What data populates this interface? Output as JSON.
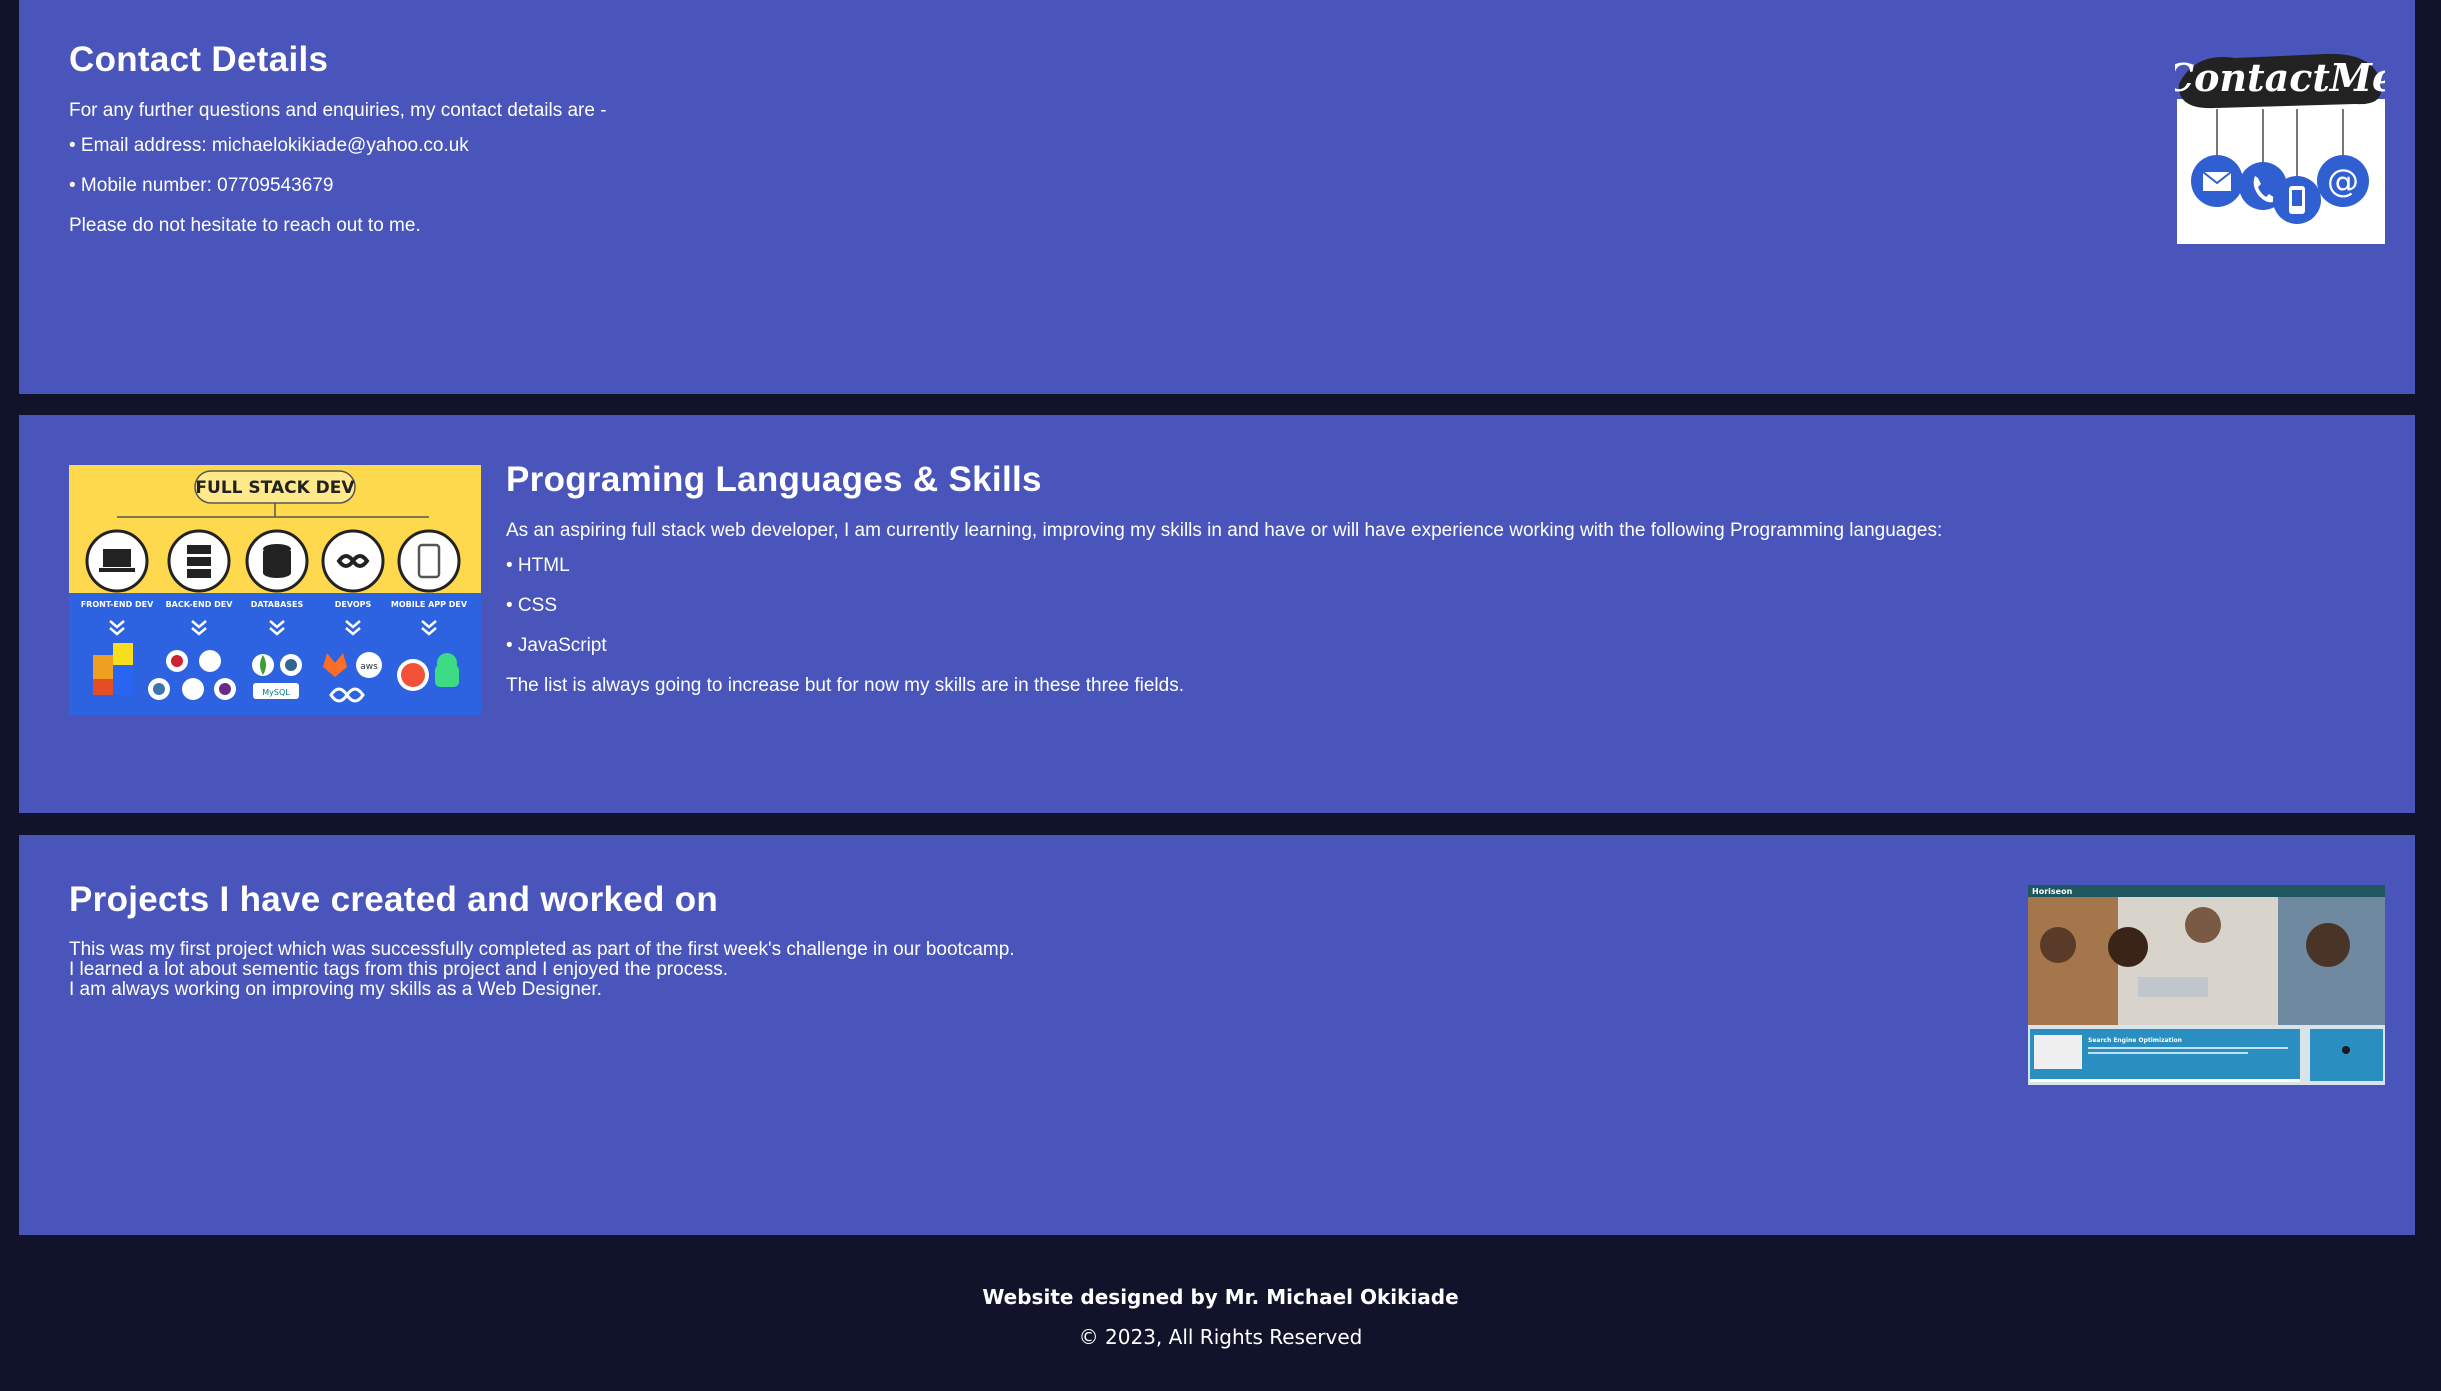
{
  "contact": {
    "title": "Contact Details",
    "intro": "For any further questions and enquiries, my contact details are -",
    "email_line": "• Email address: michaelokikiade@yahoo.co.uk",
    "mobile_line": "• Mobile number: 07709543679",
    "outro": "Please do not hesitate to reach out to me.",
    "image_caption": "ContactMe"
  },
  "skills": {
    "image": {
      "header": "FULL STACK DEV",
      "columns": [
        "FRONT-END DEV",
        "BACK-END DEV",
        "DATABASES",
        "DEVOPS",
        "MOBILE APP DEV"
      ]
    },
    "title": "Programing Languages & Skills",
    "intro": "As an aspiring full stack web developer, I am currently learning, improving my skills in and have or will have experience working with the following Programming languages:",
    "languages": [
      "• HTML",
      "• CSS",
      "• JavaScript"
    ],
    "outro": "The list is always going to increase but for now my skills are in these three fields."
  },
  "projects": {
    "title": "Projects I have created and worked on",
    "lines": [
      "This was my first project which was successfully completed as part of the first week's challenge in our bootcamp.",
      "I learned a lot about sementic tags from this project and I enjoyed the process.",
      "I am always working on improving my skills as a Web Designer."
    ],
    "screenshot": {
      "brand": "Horiseon",
      "section_title": "Search Engine Optimization"
    }
  },
  "footer": {
    "credit": "Website designed by Mr. Michael Okikiade",
    "copyright": "© 2023, All Rights Reserved"
  },
  "colors": {
    "page_bg": "#11132b",
    "panel_bg": "#4a55bb",
    "accent_yellow": "#ffd94d",
    "accent_blue": "#2d62e0"
  }
}
